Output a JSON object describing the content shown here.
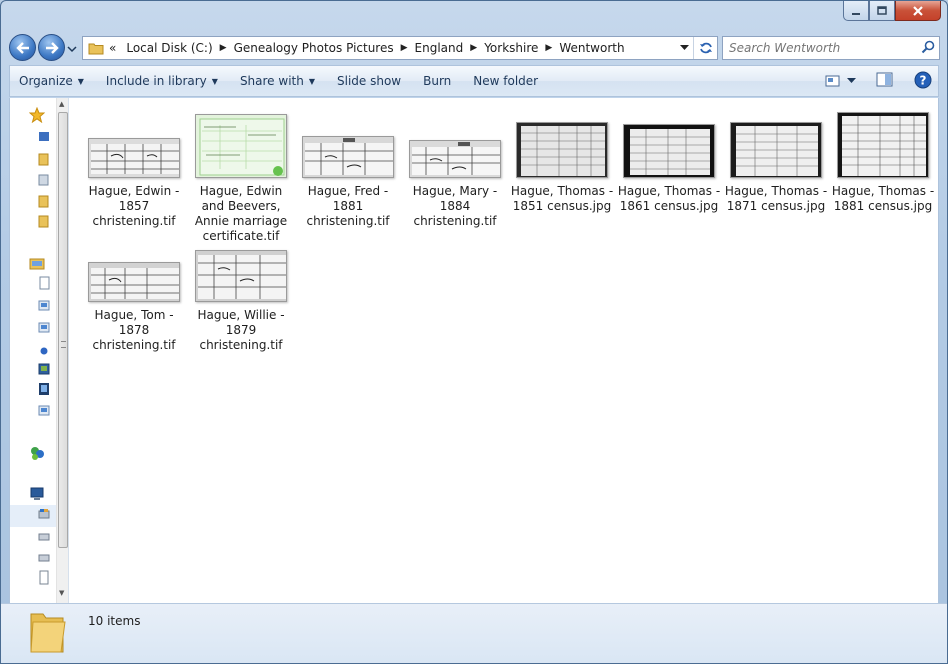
{
  "window": {
    "title": "Wentworth"
  },
  "caption_buttons": [
    "minimize",
    "maximize",
    "close"
  ],
  "address": {
    "overflow_marker": "«",
    "crumbs": [
      "Local Disk (C:)",
      "Genealogy Photos Pictures",
      "England",
      "Yorkshire",
      "Wentworth"
    ]
  },
  "search": {
    "placeholder": "Search Wentworth"
  },
  "toolbar": {
    "organize": "Organize",
    "include_in_library": "Include in library",
    "share_with": "Share with",
    "slide_show": "Slide show",
    "burn": "Burn",
    "new_folder": "New folder"
  },
  "files": [
    {
      "name": "Hague, Edwin - 1857 christening.tif",
      "kind": "christening"
    },
    {
      "name": "Hague, Edwin and Beevers, Annie marriage certificate.tif",
      "kind": "certificate"
    },
    {
      "name": "Hague, Fred - 1881 christening.tif",
      "kind": "christening"
    },
    {
      "name": "Hague, Mary - 1884 christening.tif",
      "kind": "christening"
    },
    {
      "name": "Hague, Thomas - 1851 census.jpg",
      "kind": "census"
    },
    {
      "name": "Hague, Thomas - 1861 census.jpg",
      "kind": "census"
    },
    {
      "name": "Hague, Thomas - 1871 census.jpg",
      "kind": "census"
    },
    {
      "name": "Hague, Thomas - 1881 census.jpg",
      "kind": "census"
    },
    {
      "name": "Hague, Tom - 1878 christening.tif",
      "kind": "christening"
    },
    {
      "name": "Hague, Willie - 1879 christening.tif",
      "kind": "christening"
    }
  ],
  "labels": {
    "f0": [
      "Hague, Edwin -",
      "1857",
      "christening.tif"
    ],
    "f1": [
      "Hague, Edwin",
      "and Beevers,",
      "Annie marriage",
      "certificate.tif"
    ],
    "f2": [
      "Hague, Fred -",
      "1881",
      "christening.tif"
    ],
    "f3": [
      "Hague, Mary -",
      "1884",
      "christening.tif"
    ],
    "f4": [
      "Hague, Thomas -",
      "1851 census.jpg"
    ],
    "f5": [
      "Hague, Thomas -",
      "1861 census.jpg"
    ],
    "f6": [
      "Hague, Thomas -",
      "1871 census.jpg"
    ],
    "f7": [
      "Hague, Thomas -",
      "1881 census.jpg"
    ],
    "f8": [
      "Hague, Tom -",
      "1878",
      "christening.tif"
    ],
    "f9": [
      "Hague, Willie -",
      "1879",
      "christening.tif"
    ]
  },
  "status": {
    "item_count": "10 items"
  },
  "colors": {
    "accent": "#1e395b",
    "frame": "#b3cbe5",
    "close": "#c4412a"
  }
}
